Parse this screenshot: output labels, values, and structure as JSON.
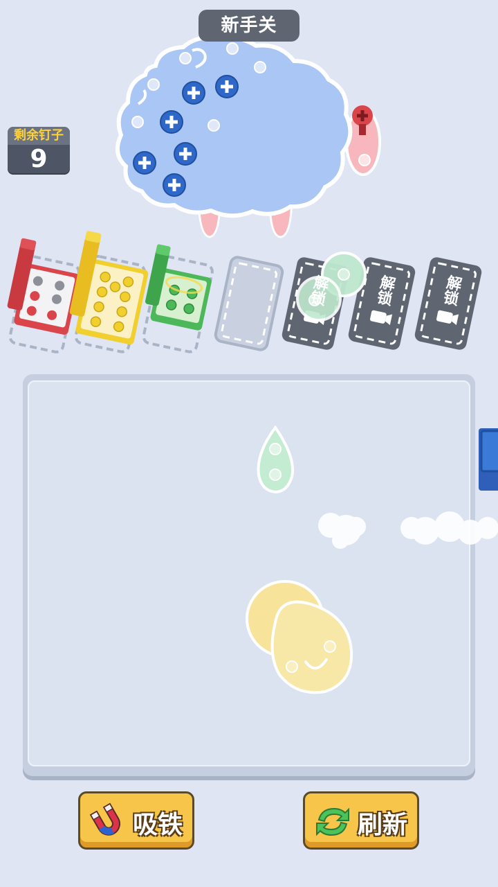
{
  "level": {
    "title": "新手关"
  },
  "counter": {
    "label": "剩余钉子",
    "value": "9"
  },
  "slots": [
    {
      "state": "filled",
      "color": "red"
    },
    {
      "state": "filled",
      "color": "yellow"
    },
    {
      "state": "filled",
      "color": "green"
    },
    {
      "state": "empty"
    },
    {
      "state": "locked",
      "label": "解锁",
      "icon": "video-icon"
    },
    {
      "state": "locked",
      "label": "解锁",
      "icon": "video-icon"
    },
    {
      "state": "locked",
      "label": "解锁",
      "icon": "video-icon"
    }
  ],
  "buttons": {
    "magnet": {
      "label": "吸铁",
      "icon": "magnet-icon"
    },
    "refresh": {
      "label": "刷新",
      "icon": "refresh-icon"
    }
  },
  "colors": {
    "background": "#dfe5f3",
    "sheep_body": "#a9c6f5",
    "screw_blue": "#2f68c8",
    "screw_red": "#d9454a",
    "screw_yellow": "#f1cf2e",
    "screw_green": "#4db85a",
    "button_gold": "#f6c54a"
  }
}
